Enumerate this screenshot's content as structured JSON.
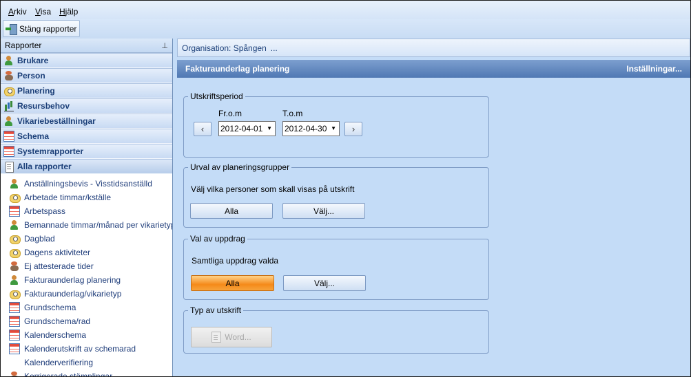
{
  "menu": {
    "file": {
      "accel": "A",
      "rest": "rkiv"
    },
    "view": {
      "accel": "V",
      "rest": "isa"
    },
    "help": {
      "accel": "H",
      "rest": "jälp"
    }
  },
  "toolbar": {
    "close_reports_label": "Stäng rapporter",
    "close_reports_icon": "exit-icon"
  },
  "sidebar": {
    "header": "Rapporter",
    "pin_glyph": "⊥",
    "categories": [
      {
        "label": "Brukare",
        "icon": "person-icon"
      },
      {
        "label": "Person",
        "icon": "person-icon"
      },
      {
        "label": "Planering",
        "icon": "clock-icon"
      },
      {
        "label": "Resursbehov",
        "icon": "chart-icon"
      },
      {
        "label": "Vikariebeställningar",
        "icon": "person-icon"
      },
      {
        "label": "Schema",
        "icon": "calendar-icon"
      },
      {
        "label": "Systemrapporter",
        "icon": "calendar-icon"
      },
      {
        "label": "Alla rapporter",
        "icon": "document-icon"
      }
    ],
    "reports": [
      {
        "label": "Anställningsbevis - Visstidsanställd",
        "icon": "person-icon"
      },
      {
        "label": "Arbetade timmar/kställe",
        "icon": "clock-icon"
      },
      {
        "label": "Arbetspass",
        "icon": "calendar-icon"
      },
      {
        "label": "Bemannade timmar/månad per vikarietyp",
        "icon": "person-icon"
      },
      {
        "label": "Dagblad",
        "icon": "clock-icon"
      },
      {
        "label": "Dagens aktiviteter",
        "icon": "clock-icon"
      },
      {
        "label": "Ej attesterade tider",
        "icon": "person-icon"
      },
      {
        "label": "Fakturaunderlag planering",
        "icon": "person-icon"
      },
      {
        "label": "Fakturaunderlag/vikarietyp",
        "icon": "clock-icon"
      },
      {
        "label": "Grundschema",
        "icon": "calendar-icon"
      },
      {
        "label": "Grundschema/rad",
        "icon": "calendar-icon"
      },
      {
        "label": "Kalenderschema",
        "icon": "calendar-icon"
      },
      {
        "label": "Kalenderutskrift av schemarad",
        "icon": "calendar-icon"
      },
      {
        "label": "Kalenderverifiering",
        "icon": ""
      },
      {
        "label": "Korrigerade stämplingar",
        "icon": "person-icon"
      }
    ]
  },
  "org": {
    "label": "Organisation: Spången",
    "ellipsis": "..."
  },
  "panel": {
    "title": "Fakturaunderlag planering",
    "settings_link": "Inställningar..."
  },
  "period": {
    "legend": "Utskriftsperiod",
    "from_label": "Fr.o.m",
    "to_label": "T.o.m",
    "from_value": "2012-04-01",
    "to_value": "2012-04-30",
    "prev_glyph": "‹",
    "next_glyph": "›",
    "dropdown_glyph": "▼"
  },
  "groups": {
    "legend": "Urval av planeringsgrupper",
    "text": "Välj vilka personer som skall visas på utskrift",
    "all_label": "Alla",
    "choose_label": "Välj..."
  },
  "assignments": {
    "legend": "Val av uppdrag",
    "text": "Samtliga uppdrag valda",
    "all_label": "Alla",
    "choose_label": "Välj..."
  },
  "output": {
    "legend": "Typ av utskrift",
    "word_label": "Word...",
    "word_icon": "word-icon"
  }
}
